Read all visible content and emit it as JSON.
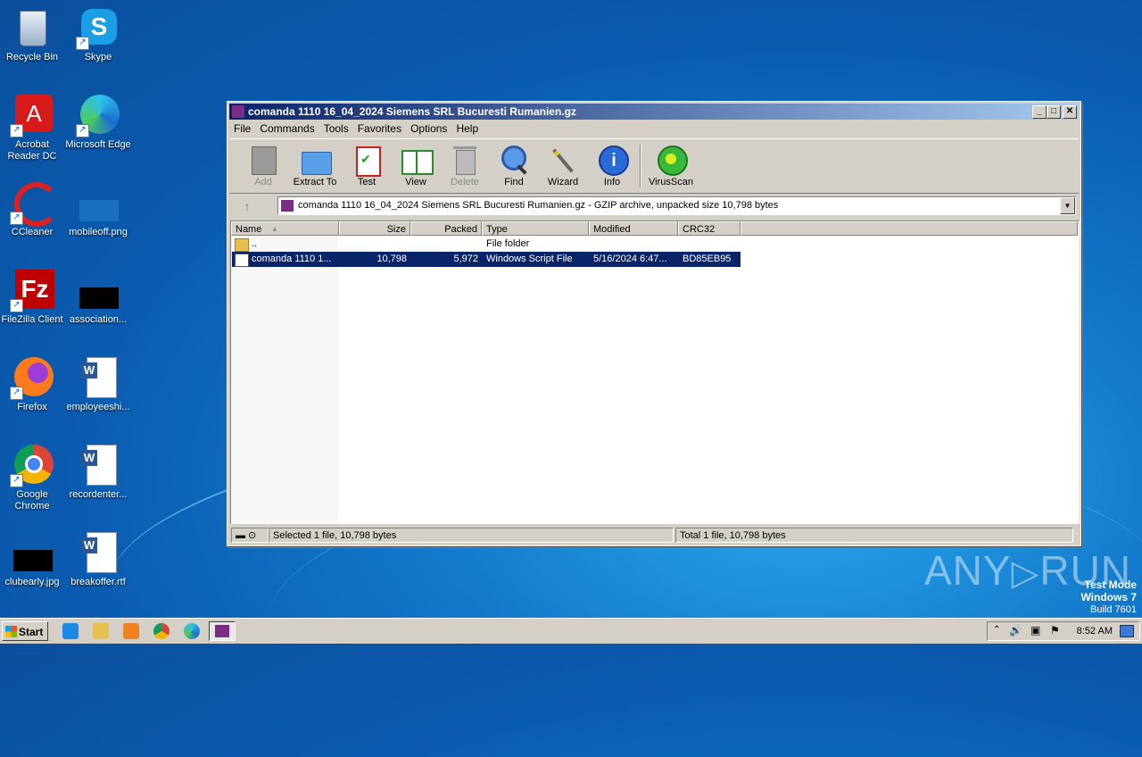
{
  "desktop": {
    "icons": [
      {
        "label": "Recycle Bin"
      },
      {
        "label": "Skype"
      },
      {
        "label": "Acrobat Reader DC"
      },
      {
        "label": "Microsoft Edge"
      },
      {
        "label": "CCleaner"
      },
      {
        "label": "mobileoff.png"
      },
      {
        "label": "FileZilla Client"
      },
      {
        "label": "association..."
      },
      {
        "label": "Firefox"
      },
      {
        "label": "employeeshi..."
      },
      {
        "label": "Google Chrome"
      },
      {
        "label": "recordenter..."
      },
      {
        "label": "clubearly.jpg"
      },
      {
        "label": "breakoffer.rtf"
      }
    ]
  },
  "window": {
    "title": "comanda 1110  16_04_2024 Siemens SRL Bucuresti Rumanien.gz",
    "menu": [
      "File",
      "Commands",
      "Tools",
      "Favorites",
      "Options",
      "Help"
    ],
    "toolbar": [
      {
        "label": "Add",
        "icon": "add-archive-icon",
        "disabled": true
      },
      {
        "label": "Extract To",
        "icon": "extract-folder-icon",
        "disabled": false
      },
      {
        "label": "Test",
        "icon": "test-checklist-icon",
        "disabled": false
      },
      {
        "label": "View",
        "icon": "view-book-icon",
        "disabled": false
      },
      {
        "label": "Delete",
        "icon": "trash-icon",
        "disabled": true
      },
      {
        "label": "Find",
        "icon": "magnifier-icon",
        "disabled": false
      },
      {
        "label": "Wizard",
        "icon": "wand-icon",
        "disabled": false
      },
      {
        "label": "Info",
        "icon": "info-icon",
        "disabled": false
      },
      {
        "label": "VirusScan",
        "icon": "virus-scan-icon",
        "disabled": false
      }
    ],
    "address": "comanda 1110  16_04_2024 Siemens SRL Bucuresti Rumanien.gz - GZIP archive, unpacked size 10,798 bytes",
    "columns": [
      "Name",
      "Size",
      "Packed",
      "Type",
      "Modified",
      "CRC32"
    ],
    "rows": [
      {
        "name": "..",
        "size": "",
        "packed": "",
        "type": "File folder",
        "modified": "",
        "crc": "",
        "selected": false
      },
      {
        "name": "comanda 1110  1...",
        "size": "10,798",
        "packed": "5,972",
        "type": "Windows Script File",
        "modified": "5/16/2024 6:47...",
        "crc": "BD85EB95",
        "selected": true
      }
    ],
    "status_left": "Selected 1 file, 10,798 bytes",
    "status_right": "Total 1 file, 10,798 bytes"
  },
  "taskbar": {
    "start_label": "Start",
    "clock": "8:52 AM"
  },
  "watermark": {
    "brand_left": "ANY",
    "brand_right": "RUN",
    "line1": "Test Mode",
    "line2": "Windows 7",
    "line3": "Build 7601"
  },
  "colors": {
    "title_active": "#0a246a",
    "selection": "#0a246a",
    "face": "#d4d0c8"
  }
}
